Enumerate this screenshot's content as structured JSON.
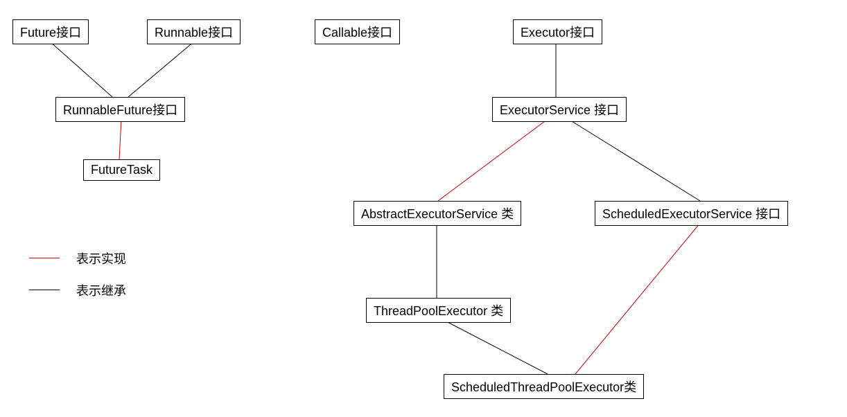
{
  "nodes": {
    "future": {
      "label": "Future接口"
    },
    "runnable": {
      "label": "Runnable接口"
    },
    "callable": {
      "label": "Callable接口"
    },
    "executor": {
      "label": "Executor接口"
    },
    "runnableFuture": {
      "label": "RunnableFuture接口"
    },
    "executorService": {
      "label": "ExecutorService 接口"
    },
    "futureTask": {
      "label": "FutureTask"
    },
    "abstractExecSvc": {
      "label": "AbstractExecutorService 类"
    },
    "schedExecSvc": {
      "label": "ScheduledExecutorService 接口"
    },
    "threadPoolExec": {
      "label": "ThreadPoolExecutor 类"
    },
    "schedThreadPool": {
      "label": "ScheduledThreadPoolExecutor类"
    }
  },
  "legend": {
    "impl": {
      "label": "表示实现",
      "color": "#cc0000"
    },
    "inherit": {
      "label": "表示继承",
      "color": "#000000"
    }
  },
  "colors": {
    "implements": "#cc0000",
    "extends": "#000000"
  }
}
